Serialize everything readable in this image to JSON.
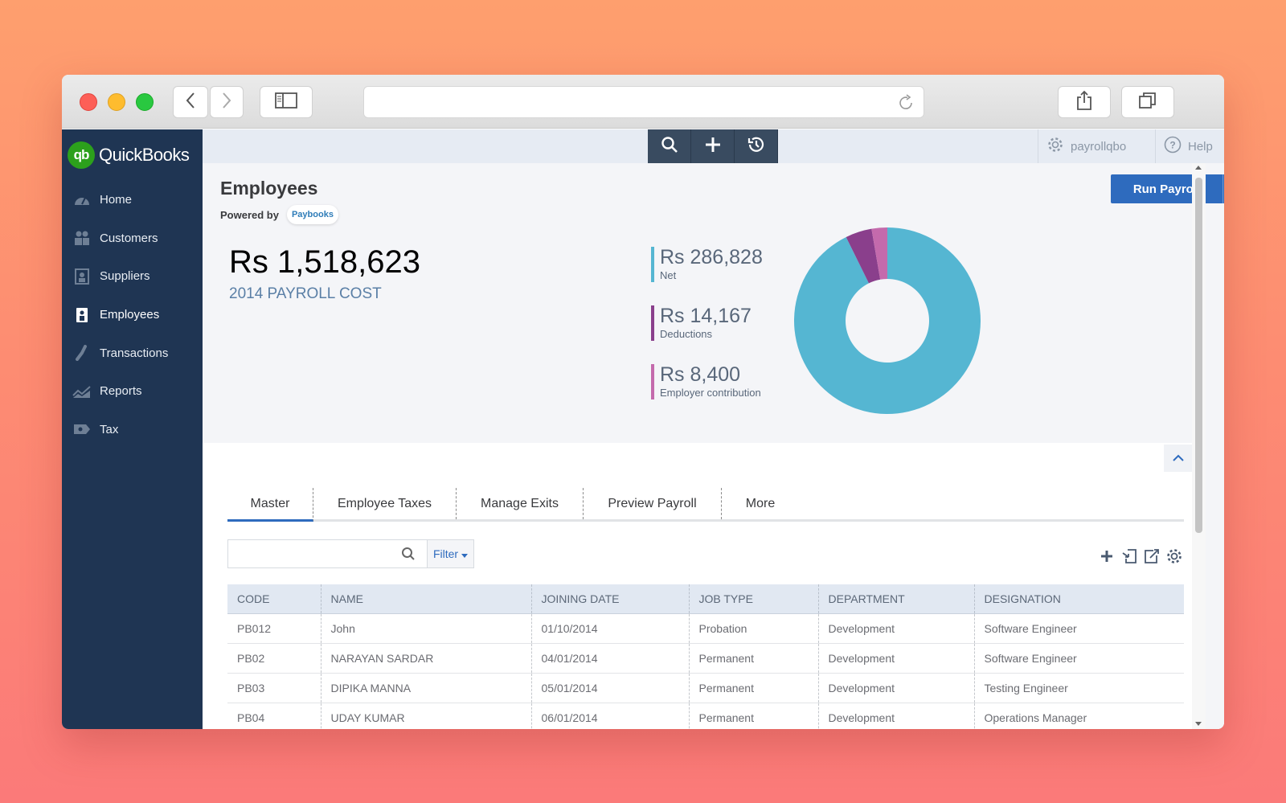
{
  "browser": {
    "address": "",
    "icons": [
      "back-icon",
      "forward-icon",
      "sidebar-toggle-icon",
      "reload-icon",
      "share-icon",
      "tabs-icon"
    ]
  },
  "app": {
    "logo_mark": "qb",
    "logo_text": "QuickBooks"
  },
  "sidebar": {
    "items": [
      {
        "label": "Home",
        "icon": "dashboard-icon"
      },
      {
        "label": "Customers",
        "icon": "customers-icon"
      },
      {
        "label": "Suppliers",
        "icon": "suppliers-icon"
      },
      {
        "label": "Employees",
        "icon": "employees-icon"
      },
      {
        "label": "Transactions",
        "icon": "transactions-icon"
      },
      {
        "label": "Reports",
        "icon": "reports-icon"
      },
      {
        "label": "Tax",
        "icon": "tax-icon"
      }
    ],
    "active": "Employees"
  },
  "topbar": {
    "quick_actions": [
      "search-icon",
      "plus-icon",
      "recent-icon"
    ],
    "company": "payrollqbo",
    "help": "Help"
  },
  "header": {
    "title": "Employees",
    "powered_by": "Powered by",
    "partner": "Paybooks",
    "run_payroll": "Run Payroll"
  },
  "summary": {
    "total": "Rs 1,518,623",
    "total_label": "2014 PAYROLL COST",
    "breakdown": [
      {
        "amount": "Rs 286,828",
        "label": "Net",
        "color": "#55b6d2"
      },
      {
        "amount": "Rs 14,167",
        "label": "Deductions",
        "color": "#8a3f8c"
      },
      {
        "amount": "Rs 8,400",
        "label": "Employer contribution",
        "color": "#c46aac"
      }
    ]
  },
  "chart_data": {
    "type": "pie",
    "labels": [
      "Net",
      "Deductions",
      "Employer contribution"
    ],
    "values": [
      286828,
      14167,
      8400
    ],
    "colors": [
      "#55b6d2",
      "#8a3f8c",
      "#c46aac"
    ],
    "donut": true
  },
  "tabs": [
    "Master",
    "Employee Taxes",
    "Manage Exits",
    "Preview Payroll",
    "More"
  ],
  "active_tab": "Master",
  "search": {
    "placeholder": "",
    "filter_label": "Filter"
  },
  "table": {
    "headers": [
      "CODE",
      "NAME",
      "JOINING DATE",
      "JOB TYPE",
      "DEPARTMENT",
      "DESIGNATION"
    ],
    "rows": [
      [
        "PB012",
        "John",
        "01/10/2014",
        "Probation",
        "Development",
        "Software Engineer"
      ],
      [
        "PB02",
        "NARAYAN SARDAR",
        "04/01/2014",
        "Permanent",
        "Development",
        "Software Engineer"
      ],
      [
        "PB03",
        "DIPIKA MANNA",
        "05/01/2014",
        "Permanent",
        "Development",
        "Testing Engineer"
      ],
      [
        "PB04",
        "UDAY KUMAR",
        "06/01/2014",
        "Permanent",
        "Development",
        "Operations Manager"
      ]
    ]
  },
  "colors": {
    "sidebar_bg": "#1f3553",
    "primary": "#2e6bbe",
    "brand_green": "#2ca01c"
  }
}
